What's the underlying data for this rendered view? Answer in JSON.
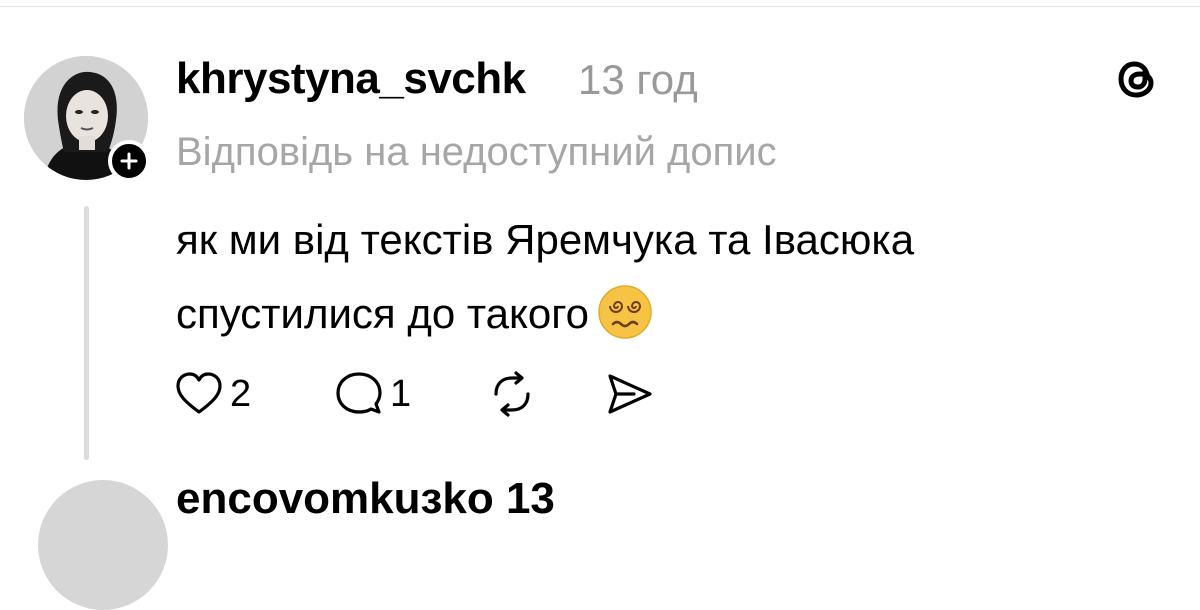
{
  "post": {
    "username": "khrystyna_svchk",
    "time": "13 год",
    "reply_context": "Відповідь на недоступний допис",
    "text_line1": "як ми від текстів Яремчука та Івасюка",
    "text_line2": "спустилися до такого",
    "emoji": "dizzy-face-emoji",
    "likes": "2",
    "comments": "1"
  },
  "next_post": {
    "username": "еnсоvоmkuзkо 13"
  },
  "colors": {
    "muted_text": "#999999",
    "thread_line": "#dcdcdc"
  }
}
